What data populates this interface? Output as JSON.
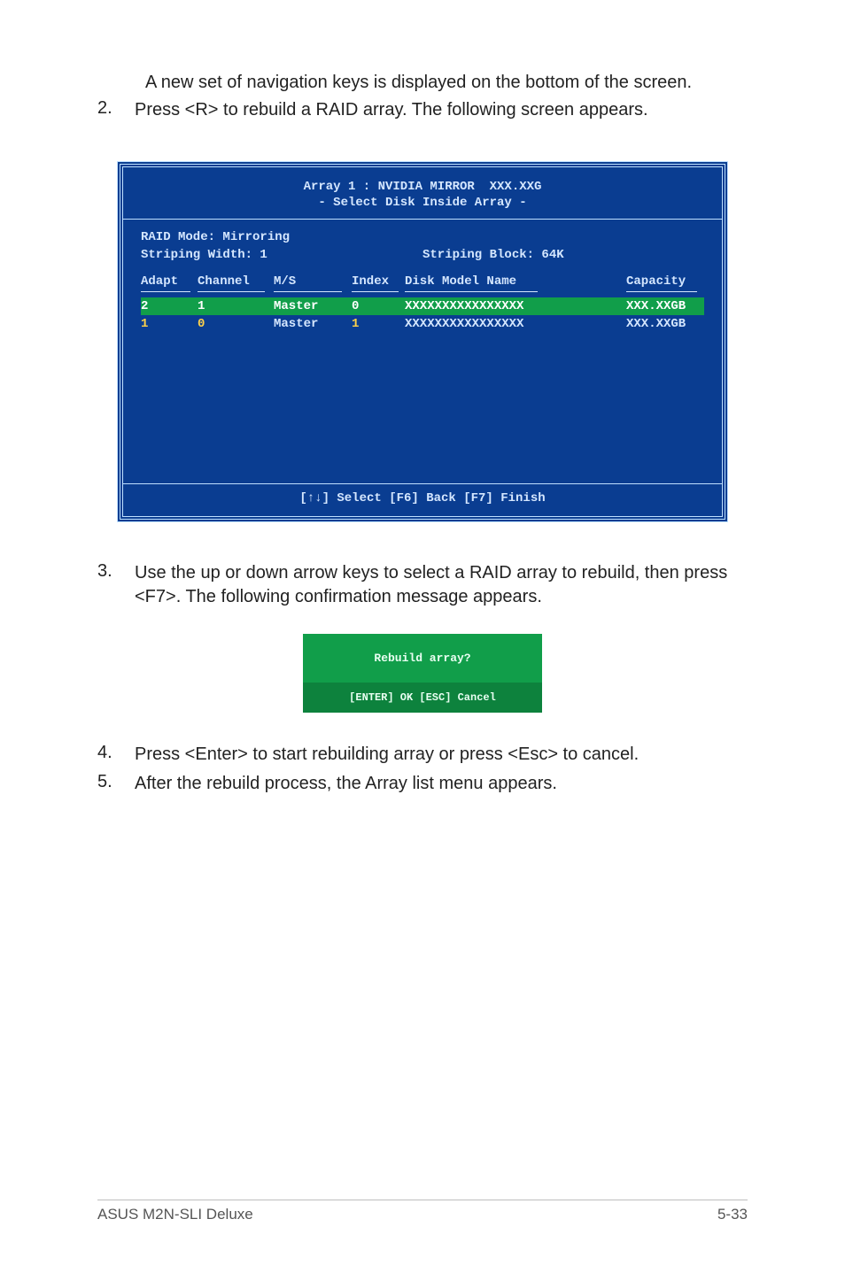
{
  "intro_line": "A new set of  navigation keys is displayed on the bottom of the screen.",
  "steps": {
    "s2": {
      "num": "2.",
      "text": "Press <R> to rebuild a RAID array. The following screen appears."
    },
    "s3": {
      "num": "3.",
      "text": "Use the up or down arrow keys to select a RAID array to rebuild, then press <F7>. The following confirmation message appears."
    },
    "s4": {
      "num": "4.",
      "text": "Press <Enter> to start rebuilding array or press <Esc> to cancel."
    },
    "s5": {
      "num": "5.",
      "text": "After the rebuild process, the Array list menu appears."
    }
  },
  "bios": {
    "title": "Array 1 : NVIDIA MIRROR  XXX.XXG",
    "subtitle": "- Select Disk Inside Array -",
    "raid_mode_label": "RAID Mode: Mirroring",
    "striping_width_label": "Striping Width: 1",
    "striping_block_label": "Striping Block: 64K",
    "headers": {
      "adapt": "Adapt",
      "channel": "Channel",
      "ms": "M/S",
      "index": "Index",
      "model": "Disk Model Name",
      "capacity": "Capacity"
    },
    "rows": [
      {
        "adapt": "2",
        "channel": "1",
        "ms": "Master",
        "index": "0",
        "model": "XXXXXXXXXXXXXXXX",
        "capacity": "XXX.XXGB",
        "selected": true
      },
      {
        "adapt": "1",
        "channel": "0",
        "ms": "Master",
        "index": "1",
        "model": "XXXXXXXXXXXXXXXX",
        "capacity": "XXX.XXGB",
        "selected": false
      }
    ],
    "footer": "[↑↓] Select [F6] Back  [F7] Finish"
  },
  "confirm": {
    "question": "Rebuild array?",
    "buttons": "[ENTER] OK  [ESC] Cancel"
  },
  "page_footer": {
    "left": "ASUS M2N-SLI Deluxe",
    "right": "5-33"
  }
}
